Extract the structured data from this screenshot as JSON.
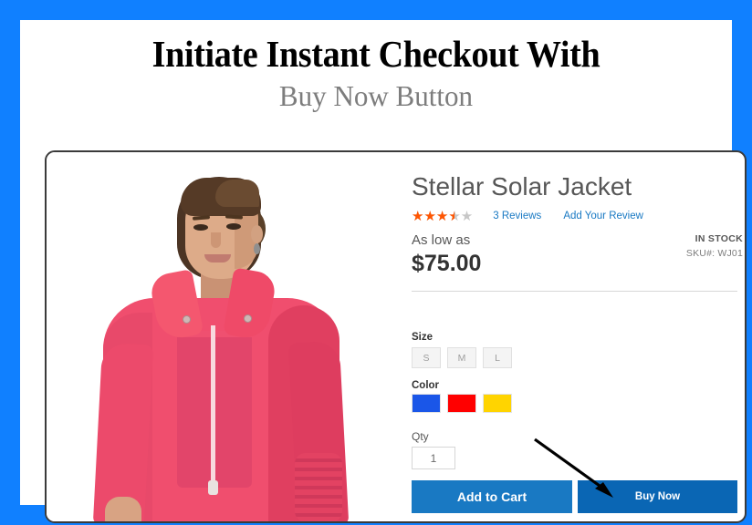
{
  "headline": {
    "title": "Initiate Instant Checkout With",
    "subtitle": "Buy Now Button"
  },
  "product": {
    "name": "Stellar Solar Jacket",
    "rating": {
      "value": 3.5,
      "max": 5,
      "stars_glyph": "★★★★★",
      "filled_color": "#ff5501",
      "empty_color": "#c7c7c7"
    },
    "reviews_count_label": "3  Reviews",
    "add_review_label": "Add Your Review",
    "price_prefix": "As low as",
    "price": "$75.00",
    "stock_status": "IN STOCK",
    "sku": "SKU#:  WJ01",
    "image_alt": "model wearing pink stellar solar jacket"
  },
  "options": {
    "size": {
      "label": "Size",
      "values": [
        "S",
        "M",
        "L"
      ]
    },
    "color": {
      "label": "Color",
      "values": [
        {
          "name": "blue",
          "hex": "#1a56e8"
        },
        {
          "name": "red",
          "hex": "#ff0000"
        },
        {
          "name": "yellow",
          "hex": "#ffd400"
        }
      ]
    },
    "qty": {
      "label": "Qty",
      "value": "1"
    }
  },
  "actions": {
    "add_to_cart_label": "Add to Cart",
    "buy_now_label": "Buy Now"
  },
  "colors": {
    "frame_blue": "#1080ff",
    "add_to_cart_blue": "#1979c3",
    "buy_now_blue": "#0a66b4",
    "link_blue": "#1979c3",
    "title_gray": "#575757",
    "subtitle_gray": "#7d7d7d",
    "jacket_pink": "#f04e6e"
  },
  "annotation": {
    "type": "arrow",
    "points_to": "buy-now-button"
  }
}
